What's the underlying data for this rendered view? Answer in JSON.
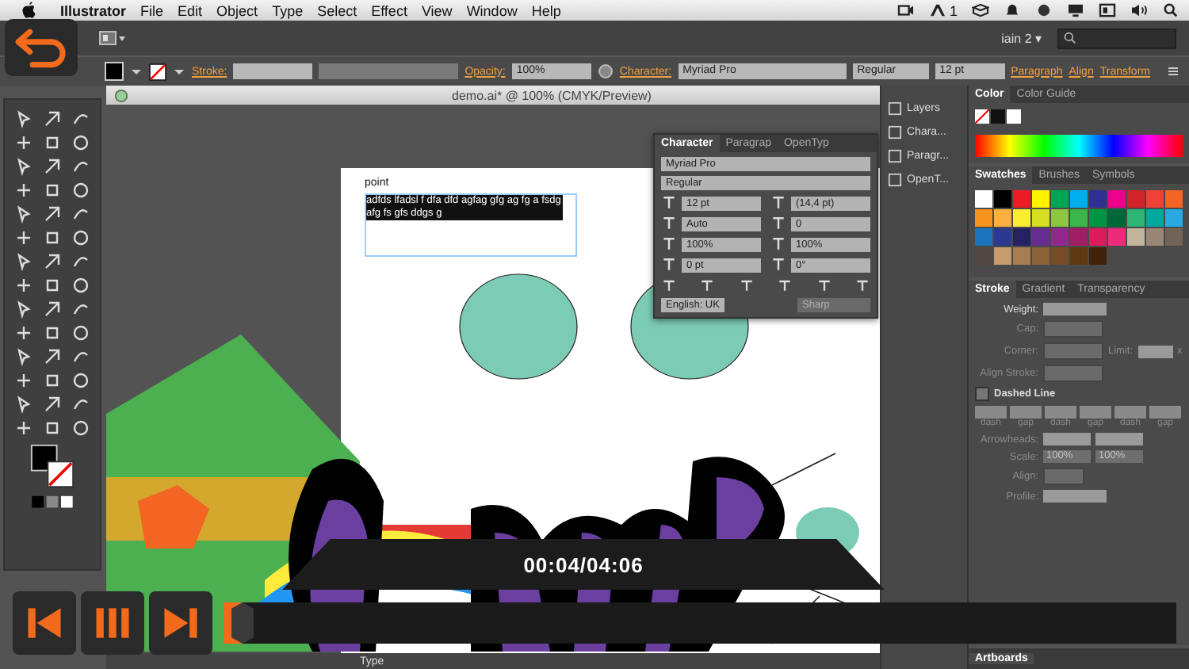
{
  "menu_bar": {
    "app": "Illustrator",
    "items": [
      "File",
      "Edit",
      "Object",
      "Type",
      "Select",
      "Effect",
      "View",
      "Window",
      "Help"
    ],
    "status_text": "1"
  },
  "app_bar": {
    "workspace": "iain 2",
    "workspace_caret": "▾"
  },
  "control_bar": {
    "stroke_label": "Stroke:",
    "opacity_label": "Opacity:",
    "opacity": "100%",
    "character_label": "Character:",
    "font": "Myriad Pro",
    "style": "Regular",
    "size": "12 pt",
    "links": [
      "Paragraph",
      "Align",
      "Transform"
    ]
  },
  "document": {
    "title": "demo.ai* @ 100% (CMYK/Preview)",
    "label": "point",
    "selected_text": "adfds lfadsl f dfa dfd agfag gfg ag fg a fsdg afg fs gfs ddgs g",
    "status": "Type"
  },
  "character_panel": {
    "tabs": [
      {
        "label": "Character",
        "selected": true
      },
      {
        "label": "Paragrap",
        "selected": false
      },
      {
        "label": "OpenTyp",
        "selected": false
      }
    ],
    "font": "Myriad Pro",
    "style": "Regular",
    "fields": [
      "12 pt",
      "(14,4 pt)",
      "Auto",
      "0",
      "100%",
      "100%",
      "0 pt",
      "0°"
    ],
    "language": "English: UK",
    "antialias": "Sharp"
  },
  "dock": [
    "Layers",
    "Chara...",
    "Paragr...",
    "OpenT..."
  ],
  "color_panel": {
    "tabs": [
      {
        "label": "Color",
        "selected": true
      },
      {
        "label": "Color Guide",
        "selected": false
      }
    ]
  },
  "swatches_panel": {
    "tabs": [
      {
        "label": "Swatches",
        "selected": true
      },
      {
        "label": "Brushes",
        "selected": false
      },
      {
        "label": "Symbols",
        "selected": false
      }
    ],
    "swatches": [
      {
        "color": "#ffffff"
      },
      {
        "color": "#000000"
      },
      {
        "color": "#ed1c24"
      },
      {
        "color": "#fff200"
      },
      {
        "color": "#00a651"
      },
      {
        "color": "#00aeef"
      },
      {
        "color": "#2e3192"
      },
      {
        "color": "#ec008c"
      },
      {
        "color": "#d2232a"
      },
      {
        "color": "#ef4136"
      },
      {
        "color": "#f26522"
      },
      {
        "color": "#f7941d"
      },
      {
        "color": "#fbb040"
      },
      {
        "color": "#f9ed32"
      },
      {
        "color": "#d7df23"
      },
      {
        "color": "#8dc63f"
      },
      {
        "color": "#39b54a"
      },
      {
        "color": "#009444"
      },
      {
        "color": "#006838"
      },
      {
        "color": "#2bb673"
      },
      {
        "color": "#00a79d"
      },
      {
        "color": "#27aae1"
      },
      {
        "color": "#1c75bc"
      },
      {
        "color": "#2b3990"
      },
      {
        "color": "#262262"
      },
      {
        "color": "#662d91"
      },
      {
        "color": "#92278f"
      },
      {
        "color": "#9e1f63"
      },
      {
        "color": "#da1c5c"
      },
      {
        "color": "#ee2a7b"
      },
      {
        "color": "#c2b59b"
      },
      {
        "color": "#998675"
      },
      {
        "color": "#736357"
      },
      {
        "color": "#534741"
      },
      {
        "color": "#c69c6d"
      },
      {
        "color": "#a67c52"
      },
      {
        "color": "#8c6239"
      },
      {
        "color": "#754c24"
      },
      {
        "color": "#603813"
      },
      {
        "color": "#42210b"
      }
    ]
  },
  "stroke_panel": {
    "tabs": [
      {
        "label": "Stroke",
        "selected": true
      },
      {
        "label": "Gradient",
        "selected": false
      },
      {
        "label": "Transparency",
        "selected": false
      }
    ],
    "weight_label": "Weight:",
    "cap_label": "Cap:",
    "corner_label": "Corner:",
    "limit_label": "Limit:",
    "limit_unit": "x",
    "align_stroke_label": "Align Stroke:",
    "dashed_line_label": "Dashed Line",
    "dashed_line_checked": false,
    "dash_labels": [
      "dash",
      "gap",
      "dash",
      "gap",
      "dash",
      "gap"
    ],
    "arrowheads_label": "Arrowheads:",
    "scale_label": "Scale:",
    "scale_values": [
      "100%",
      "100%"
    ],
    "align_label": "Align:",
    "profile_label": "Profile:"
  },
  "artboards_panel": {
    "label": "Artboards"
  },
  "player": {
    "time": "00:04/04:06",
    "level": 0.02
  }
}
